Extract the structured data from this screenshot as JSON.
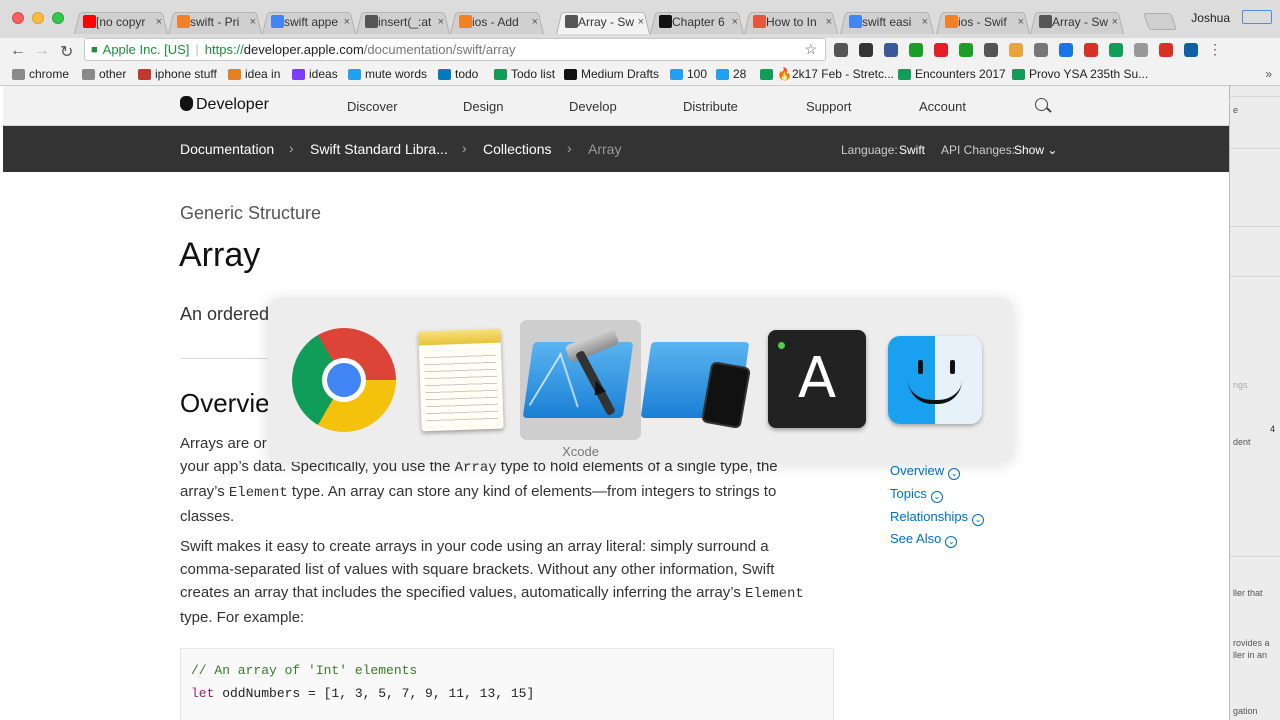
{
  "browser": {
    "tabs": [
      {
        "title": "[no copyr",
        "color": "#ff0000",
        "icon": "youtube-icon"
      },
      {
        "title": "swift - Pri",
        "color": "#f48024",
        "icon": "stackoverflow-icon"
      },
      {
        "title": "swift appe",
        "color": "#4285f4",
        "icon": "google-icon"
      },
      {
        "title": "insert(_:at",
        "color": "#555555",
        "icon": "apple-icon"
      },
      {
        "title": "ios - Add",
        "color": "#f48024",
        "icon": "stackoverflow-icon"
      },
      {
        "title": "Array - Sw",
        "color": "#555555",
        "icon": "apple-icon"
      },
      {
        "title": "Chapter 6",
        "color": "#111111",
        "icon": "heart-icon"
      },
      {
        "title": "How to In",
        "color": "#e8573c",
        "icon": "site-icon"
      },
      {
        "title": "swift easi",
        "color": "#4285f4",
        "icon": "google-icon"
      },
      {
        "title": "ios - Swif",
        "color": "#f48024",
        "icon": "stackoverflow-icon"
      },
      {
        "title": "Array - Sw",
        "color": "#555555",
        "icon": "apple-icon"
      }
    ],
    "profile_name": "Joshua",
    "address": {
      "org": "Apple Inc. [US]",
      "proto": "https://",
      "host": "developer.apple.com",
      "path": "/documentation/swift/array"
    },
    "bookmarks": [
      {
        "label": "chrome",
        "color": "#8a8a8a"
      },
      {
        "label": "other",
        "color": "#8a8a8a"
      },
      {
        "label": "iphone stuff",
        "color": "#c0392b"
      },
      {
        "label": "idea in",
        "color": "#e67e22"
      },
      {
        "label": "ideas",
        "color": "#7d3cff"
      },
      {
        "label": "mute words",
        "color": "#1da1f2"
      },
      {
        "label": "todo",
        "color": "#0079bf"
      },
      {
        "label": "Todo list",
        "color": "#0f9d58"
      },
      {
        "label": "Medium Drafts",
        "color": "#111111"
      },
      {
        "label": "100",
        "color": "#1da1f2"
      },
      {
        "label": "28",
        "color": "#1da1f2"
      },
      {
        "label": "🔥2k17 Feb - Stretc...",
        "color": "#0f9d58"
      },
      {
        "label": "Encounters 2017",
        "color": "#0f9d58"
      },
      {
        "label": "Provo YSA 235th Su...",
        "color": "#0f9d58"
      }
    ],
    "bookmarks_more": "»"
  },
  "site": {
    "logo": "Developer",
    "nav": [
      "Discover",
      "Design",
      "Develop",
      "Distribute",
      "Support",
      "Account"
    ],
    "breadcrumbs": [
      "Documentation",
      "Swift Standard Libra...",
      "Collections",
      "Array"
    ],
    "chevron": "›",
    "language_label": "Language:",
    "language_value": "Swift",
    "api_label": "API Changes:",
    "api_value": "Show ⌄"
  },
  "doc": {
    "eyebrow": "Generic Structure",
    "title": "Array",
    "abstract": "An ordered",
    "overview_heading": "Overvie",
    "p1_line1": "Arrays are or",
    "p1_line2_pre": "your app’s data. Specifically, you use the ",
    "p1_line2_code": "Array",
    "p1_line2_post": " type to hold elements of a single type, the",
    "p1_line3_pre": "array’s ",
    "p1_line3_code": "Element",
    "p1_line3_post": " type. An array can store any kind of elements—from integers to strings to",
    "p1_line4": "classes.",
    "p2_line1": "Swift makes it easy to create arrays in your code using an array literal: simply surround a",
    "p2_line2": "comma-separated list of values with square brackets. Without any other information, Swift",
    "p2_line3_pre": "creates an array that includes the specified values, automatically inferring the array’s ",
    "p2_line3_code": "Element",
    "p2_line4": "type. For example:",
    "code_comment": "// An array of 'Int' elements",
    "code_kw": "let",
    "code_rest": " oddNumbers = [1, 3, 5, 7, 9, 11, 13, 15]",
    "on_this_page": [
      "Overview",
      "Topics",
      "Relationships",
      "See Also"
    ]
  },
  "switcher": {
    "selected_label": "Xcode",
    "apps": [
      "chrome-icon",
      "notes-icon",
      "xcode-icon",
      "simulator-icon",
      "font-book-icon",
      "finder-icon"
    ],
    "font_icon_glyph": "A"
  },
  "sideapp": {
    "texts": [
      "e",
      "ngs",
      "4",
      "dent",
      "ller that",
      "rovides a",
      "ller in an",
      "gation"
    ]
  }
}
